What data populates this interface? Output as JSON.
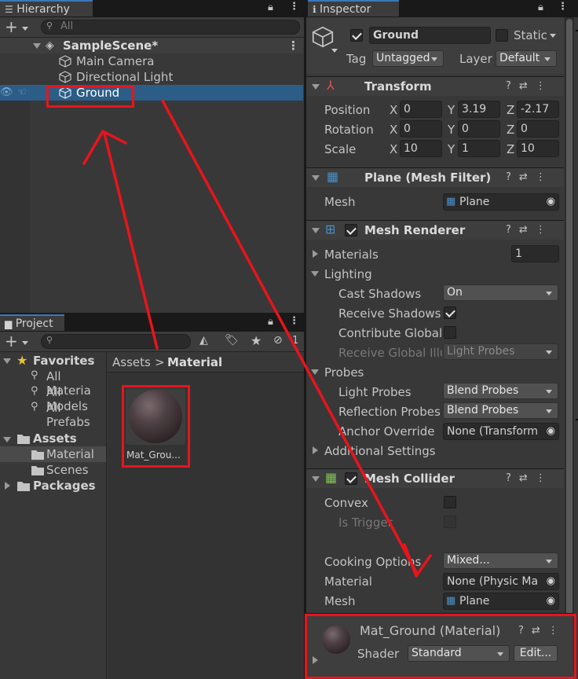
{
  "hierarchy": {
    "tab_label": "Hierarchy",
    "search_placeholder": "All",
    "scene_name": "SampleScene*",
    "items": [
      "Main Camera",
      "Directional Light",
      "Ground"
    ]
  },
  "project": {
    "tab_label": "Project",
    "favorites_label": "Favorites",
    "favorites": [
      "All Materia",
      "All Models",
      "All Prefabs"
    ],
    "assets_label": "Assets",
    "asset_folders": [
      "Material",
      "Scenes"
    ],
    "packages_label": "Packages",
    "breadcrumb_root": "Assets",
    "breadcrumb_sep": ">",
    "breadcrumb_current": "Material",
    "asset_name": "Mat_Grou...",
    "hidden_count": "1"
  },
  "inspector": {
    "tab_label": "Inspector",
    "object_name": "Ground",
    "static_label": "Static",
    "tag_label": "Tag",
    "tag_value": "Untagged",
    "layer_label": "Layer",
    "layer_value": "Default",
    "transform": {
      "title": "Transform",
      "position_label": "Position",
      "rotation_label": "Rotation",
      "scale_label": "Scale",
      "position": {
        "x": "0",
        "y": "3.19",
        "z": "-2.17"
      },
      "rotation": {
        "x": "0",
        "y": "0",
        "z": "0"
      },
      "scale": {
        "x": "10",
        "y": "1",
        "z": "10"
      },
      "axis_x": "X",
      "axis_y": "Y",
      "axis_z": "Z"
    },
    "mesh_filter": {
      "title": "Plane (Mesh Filter)",
      "mesh_label": "Mesh",
      "mesh_value": "Plane"
    },
    "mesh_renderer": {
      "title": "Mesh Renderer",
      "materials_label": "Materials",
      "materials_count": "1",
      "lighting_label": "Lighting",
      "cast_shadows_label": "Cast Shadows",
      "cast_shadows_value": "On",
      "receive_shadows_label": "Receive Shadows",
      "contribute_global_label": "Contribute Global",
      "receive_gi_label": "Receive Global Illu",
      "receive_gi_value": "Light Probes",
      "probes_label": "Probes",
      "light_probes_label": "Light Probes",
      "light_probes_value": "Blend Probes",
      "reflection_probes_label": "Reflection Probes",
      "reflection_probes_value": "Blend Probes",
      "anchor_override_label": "Anchor Override",
      "anchor_override_value": "None (Transform",
      "additional_settings_label": "Additional Settings"
    },
    "mesh_collider": {
      "title": "Mesh Collider",
      "convex_label": "Convex",
      "is_trigger_label": "Is Trigger",
      "cooking_options_label": "Cooking Options",
      "cooking_options_value": "Mixed...",
      "material_label": "Material",
      "material_value": "None (Physic Ma",
      "mesh_label": "Mesh",
      "mesh_value": "Plane"
    },
    "material_panel": {
      "title": "Mat_Ground (Material)",
      "shader_label": "Shader",
      "shader_value": "Standard",
      "edit_label": "Edit..."
    }
  },
  "colors": {
    "selection": "#2c5d87",
    "annotation_red": "#e8141c",
    "panel_bg": "#383838",
    "dark_bg": "#282828"
  }
}
